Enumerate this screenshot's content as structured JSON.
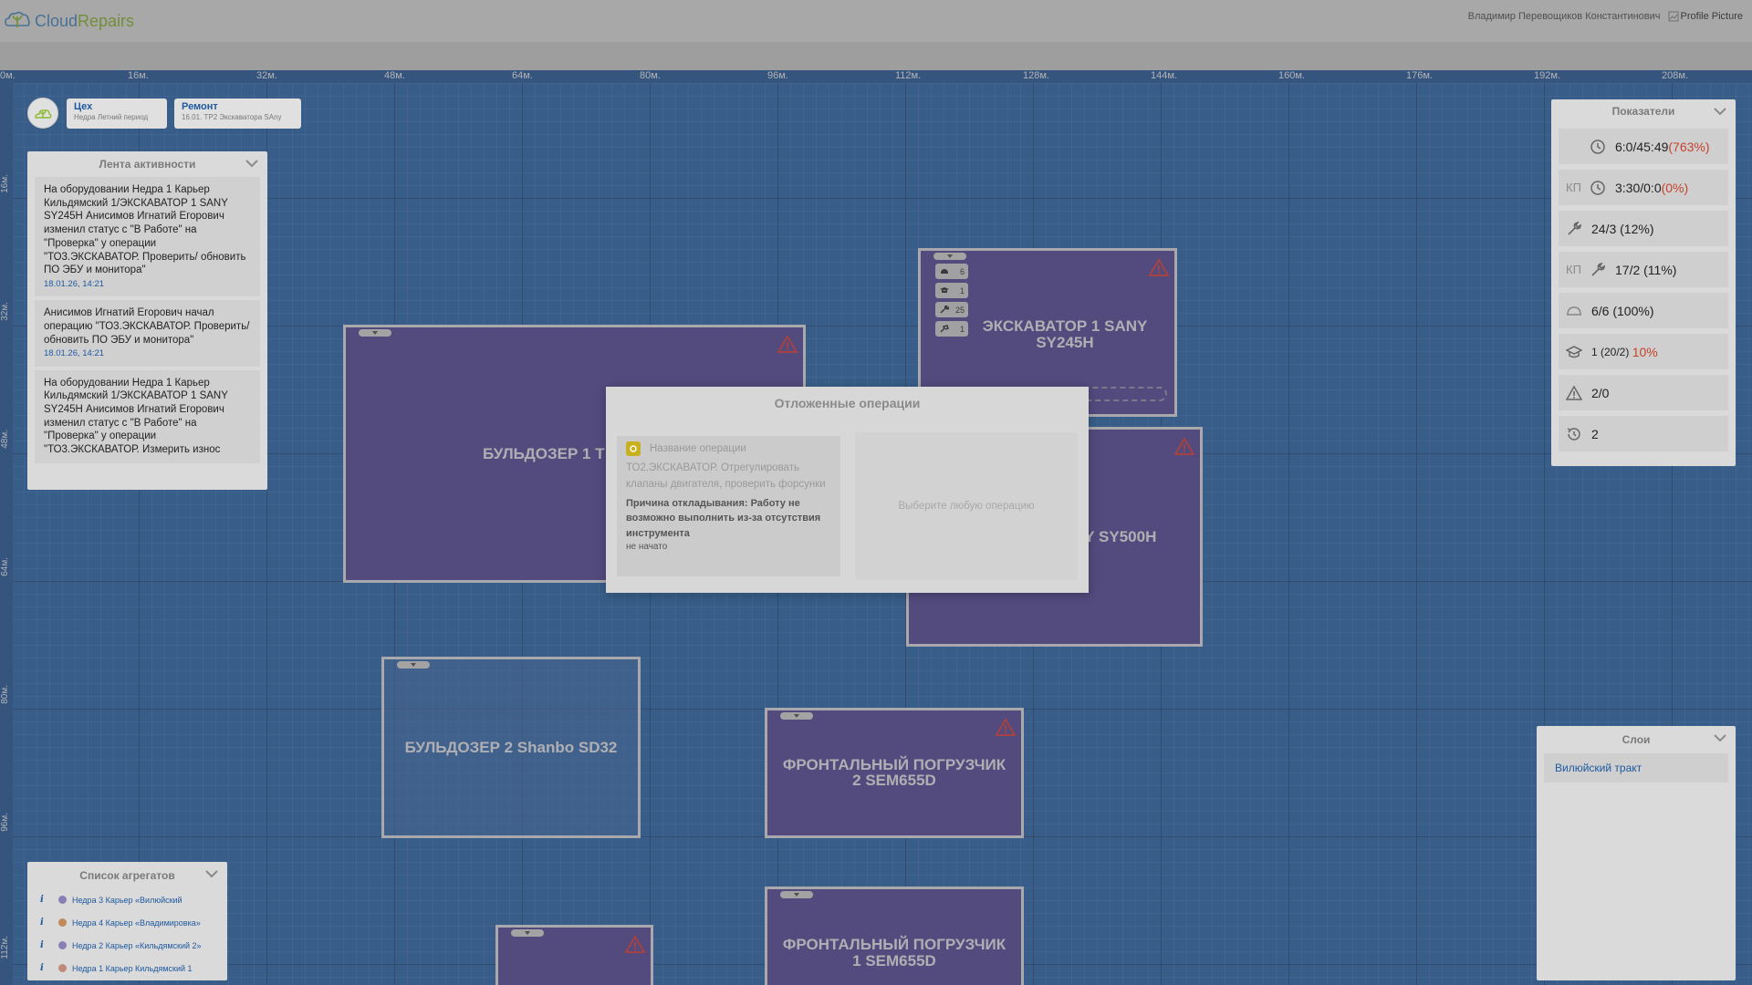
{
  "header": {
    "logo_cloud": "Cloud",
    "logo_repairs": "Repairs",
    "user_name": "Владимир Перевощиков Константинович",
    "profile_alt": "Profile Picture"
  },
  "ruler": {
    "top": [
      "0м.",
      "16м.",
      "32м.",
      "48м.",
      "64м.",
      "80м.",
      "96м.",
      "112м.",
      "128м.",
      "144м.",
      "160м.",
      "176м.",
      "192м.",
      "208м."
    ],
    "left": [
      "16м.",
      "32м.",
      "48м.",
      "64м.",
      "80м.",
      "96м.",
      "112м."
    ]
  },
  "toolbar": {
    "workshop_title": "Цех",
    "workshop_sub": "Недра Летний период",
    "repair_title": "Ремонт",
    "repair_sub": "16.01. ТР2 Экскаватора SAny"
  },
  "activity": {
    "title": "Лента активности",
    "items": [
      {
        "text": "На оборудовании Недра 1 Карьер Кильдямский 1/ЭКСКАВАТОР 1 SANY SY245H Анисимов Игнатий Егорович изменил статус с \"В Работе\" на \"Проверка\" у операции \"ТО3.ЭКСКАВАТОР. Проверить/ обновить ПО ЭБУ и монитора\"",
        "time": "18.01.26, 14:21"
      },
      {
        "text": "Анисимов Игнатий Егорович начал операцию \"ТО3.ЭКСКАВАТОР. Проверить/обновить ПО ЭБУ и монитора\"",
        "time": "18.01.26, 14:21"
      },
      {
        "text": "На оборудовании Недра 1 Карьер Кильдямский 1/ЭКСКАВАТОР 1 SANY SY245H Анисимов Игнатий Егорович изменил статус с \"В Работе\" на \"Проверка\" у операции \"ТО3.ЭКСКАВАТОР. Измерить износ",
        "time": ""
      }
    ]
  },
  "metrics": {
    "title": "Показатели",
    "items": [
      {
        "kp": "",
        "icon": "clock-icon",
        "main": "6:0/45:49 ",
        "pct": "(763%)",
        "pct_red": true
      },
      {
        "kp": "КП",
        "icon": "clock-icon",
        "main": "3:30/0:0 ",
        "pct": "(0%)",
        "pct_red": true
      },
      {
        "kp": "",
        "icon": "wrench-icon",
        "main": "24/3 (12%)",
        "pct": "",
        "pct_red": false
      },
      {
        "kp": "КП",
        "icon": "wrench-icon",
        "main": "17/2 (11%)",
        "pct": "",
        "pct_red": false
      },
      {
        "kp": "",
        "icon": "helmet-icon",
        "main": "6/6 (100%)",
        "pct": "",
        "pct_red": false
      },
      {
        "kp": "",
        "icon": "graduation-cap-icon",
        "main": "1 (20/2) ",
        "pct": "10%",
        "pct_red": true
      },
      {
        "kp": "",
        "icon": "warning-icon",
        "main": "2/0",
        "pct": "",
        "pct_red": false
      },
      {
        "kp": "",
        "icon": "history-icon",
        "main": "2",
        "pct": "",
        "pct_red": false
      }
    ]
  },
  "layers": {
    "title": "Слои",
    "items": [
      "Вилюйский тракт"
    ]
  },
  "aggregates": {
    "title": "Список агрегатов",
    "items": [
      "Недра 3 Карьер «Вилюйский",
      "Недра 4 Карьер «Владимировка»",
      "Недра 2 Карьер «Кильдямский 2»",
      "Недра 1 Карьер Кильдямский 1"
    ]
  },
  "equipment": {
    "bulldozer1": "БУЛЬДОЗЕР 1 Т",
    "excavator1": "ЭКСКАВАТОР 1 SANY SY245H",
    "excavator2_partial": "NY SY500H",
    "bulldozer2": "БУЛЬДОЗЕР 2 Shanbo SD32",
    "loader2": "ФРОНТАЛЬНЫЙ ПОГРУЗЧИК 2 SEM655D",
    "loader1": "ФРОНТАЛЬНЫЙ ПОГРУЗЧИК 1 SEM655D",
    "excavator1_chips": [
      {
        "icon": "helmet-icon",
        "value": "6"
      },
      {
        "icon": "graduation-cap-icon",
        "value": "1"
      },
      {
        "icon": "wrench-icon",
        "value": "25"
      },
      {
        "icon": "tool-icon",
        "value": "1"
      }
    ]
  },
  "modal": {
    "title": "Отложенные операции",
    "column_header": "Название операции",
    "operation_name": "ТО2.ЭКСКАВАТОР. Отрегулировать клапаны двигателя, проверить форсунки",
    "reason": "Причина откладывания: Работу не возможно выполнить из-за отсутствия инструмента",
    "status": "не начато",
    "placeholder": "Выберите любую операцию"
  },
  "colors": {
    "canvas": "#2e6bb0",
    "equipment": "#5b4d9f",
    "accent_blue": "#1f5aa0",
    "alert_red": "#c6432b",
    "op_icon": "#c9b021"
  }
}
